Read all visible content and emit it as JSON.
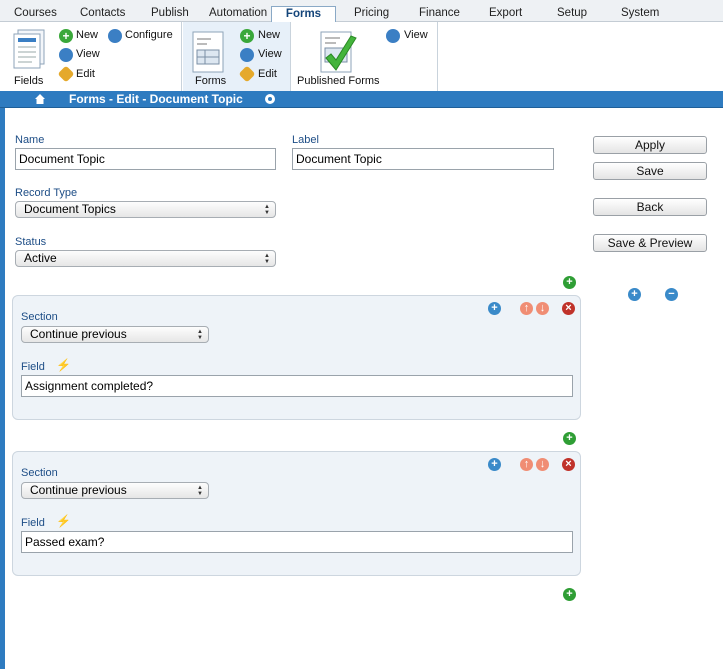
{
  "nav": {
    "tabs": [
      {
        "label": "Courses"
      },
      {
        "label": "Contacts"
      },
      {
        "label": "Publish"
      },
      {
        "label": "Automation"
      },
      {
        "label": "Forms"
      },
      {
        "label": "Pricing"
      },
      {
        "label": "Finance"
      },
      {
        "label": "Export"
      },
      {
        "label": "Setup"
      },
      {
        "label": "System"
      }
    ],
    "active_tab": "Forms"
  },
  "ribbon": {
    "fields": {
      "label": "Fields",
      "new": "New",
      "view": "View",
      "edit": "Edit",
      "configure": "Configure"
    },
    "forms": {
      "label": "Forms",
      "new": "New",
      "view": "View",
      "edit": "Edit"
    },
    "published": {
      "label": "Published Forms",
      "view": "View"
    }
  },
  "header": {
    "title": "Forms - Edit - Document Topic"
  },
  "form": {
    "name_label": "Name",
    "name_value": "Document Topic",
    "label_label": "Label",
    "label_value": "Document Topic",
    "record_type_label": "Record Type",
    "record_type_value": "Document Topics",
    "status_label": "Status",
    "status_value": "Active"
  },
  "buttons": {
    "apply": "Apply",
    "save": "Save",
    "back": "Back",
    "save_preview": "Save & Preview"
  },
  "sections": [
    {
      "section_label": "Section",
      "section_value": "Continue previous",
      "field_label": "Field",
      "field_value": "Assignment completed?"
    },
    {
      "section_label": "Section",
      "section_value": "Continue previous",
      "field_label": "Field",
      "field_value": "Passed exam?"
    }
  ],
  "colors": {
    "header_bar": "#2e7bc0",
    "label_text": "#1d4d86",
    "add_green": "#2f9e35",
    "delete_red": "#c0322a"
  },
  "icons": [
    "home-icon",
    "gear-icon",
    "add-icon",
    "remove-icon",
    "move-icon",
    "delete-icon",
    "lightning-icon",
    "document-icon",
    "checkmark-icon",
    "view-icon",
    "pencil-icon"
  ]
}
